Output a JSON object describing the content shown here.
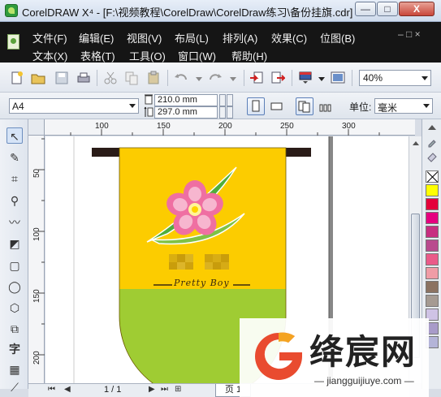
{
  "window": {
    "title": "CorelDRAW X⁴ - [F:\\视频教程\\CorelDraw\\CorelDraw练习\\备份挂旗.cdr]",
    "min_label": "—",
    "max_label": "□",
    "close_label": "X"
  },
  "menu": {
    "row1": [
      "文件(F)",
      "编辑(E)",
      "视图(V)",
      "布局(L)",
      "排列(A)",
      "效果(C)",
      "位图(B)"
    ],
    "row2": [
      "文本(X)",
      "表格(T)",
      "工具(O)",
      "窗口(W)",
      "帮助(H)"
    ],
    "mdi_controls": "– □ ×"
  },
  "toolbar": {
    "zoom_value": "40%"
  },
  "property_bar": {
    "page_size": "A4",
    "width": "210.0 mm",
    "height": "297.0 mm",
    "unit_label": "单位:",
    "unit_value": "毫米"
  },
  "rulers": {
    "h_ticks": [
      "100",
      "150",
      "200",
      "250",
      "300"
    ],
    "v_ticks": [
      "50",
      "100",
      "150",
      "200"
    ]
  },
  "artwork": {
    "script_text": "Pretty Boy",
    "colors": {
      "yellow": "#fccc00",
      "green": "#9fcc33",
      "bar": "#2a1c18",
      "petal": "#ef6fa2",
      "petal_inner": "#f7b6cf",
      "leaf": "#4fae3a"
    }
  },
  "palette": {
    "colors": [
      "#ffff00",
      "#e4003a",
      "#e5007f",
      "#c72e80",
      "#b94a8e",
      "#ea5a89",
      "#f09ca6",
      "#8b7262",
      "#a59a92",
      "#cfc3e5",
      "#a89bc9",
      "#b4b4d8"
    ]
  },
  "status": {
    "page_count": "1 / 1",
    "page_tab": "页 1"
  },
  "watermark": {
    "cn": "绛宸网",
    "en": "jiangguijiuye.com"
  }
}
